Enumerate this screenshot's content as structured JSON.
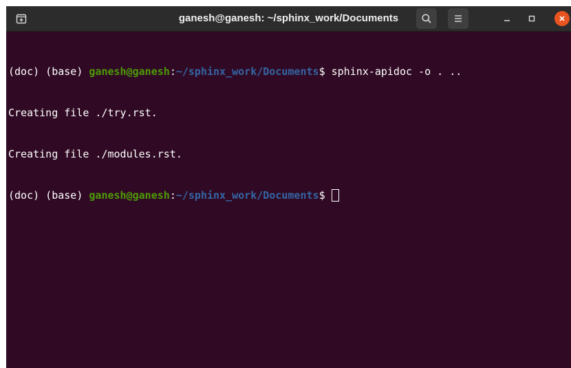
{
  "window": {
    "title": "ganesh@ganesh: ~/sphinx_work/Documents"
  },
  "titlebar": {
    "new_tab_icon": "new-tab-icon",
    "search_icon": "search-icon",
    "menu_icon": "hamburger-menu-icon",
    "minimize_icon": "minimize-icon",
    "maximize_icon": "maximize-icon",
    "close_icon": "close-icon"
  },
  "terminal": {
    "lines": [
      {
        "env": "(doc) (base) ",
        "user": "ganesh@ganesh",
        "colon": ":",
        "path": "~/sphinx_work/Documents",
        "prompt": "$ ",
        "command": "sphinx-apidoc -o . .."
      },
      {
        "text": "Creating file ./try.rst."
      },
      {
        "text": "Creating file ./modules.rst."
      },
      {
        "env": "(doc) (base) ",
        "user": "ganesh@ganesh",
        "colon": ":",
        "path": "~/sphinx_work/Documents",
        "prompt": "$ ",
        "command": ""
      }
    ]
  },
  "colors": {
    "background": "#300a24",
    "titlebar": "#2c2c2c",
    "user": "#4e9a06",
    "path": "#3465a4",
    "close": "#e95420"
  }
}
